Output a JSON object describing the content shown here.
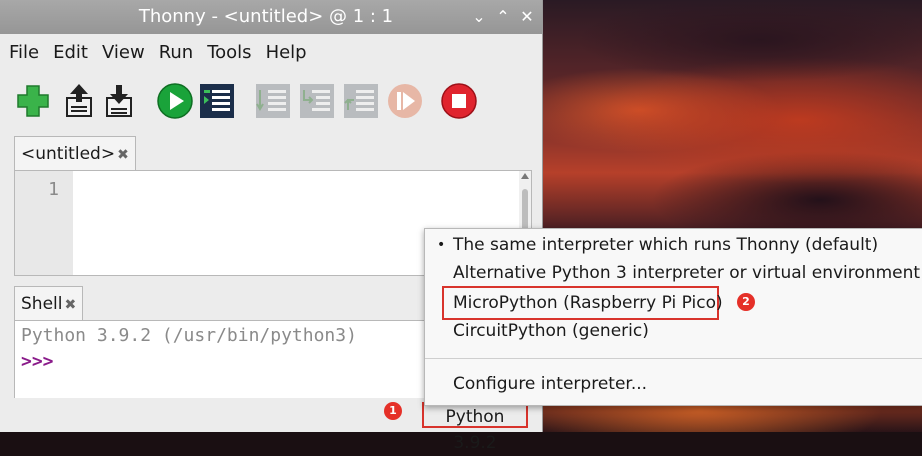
{
  "window": {
    "title": "Thonny  -  <untitled>  @  1 : 1",
    "controls": {
      "minimize": "⌄",
      "maximize": "⌃",
      "close": "✕"
    }
  },
  "menubar": [
    "File",
    "Edit",
    "View",
    "Run",
    "Tools",
    "Help"
  ],
  "toolbar": [
    {
      "name": "new-icon",
      "tooltip_role": "New",
      "enabled": true
    },
    {
      "name": "open-icon",
      "tooltip_role": "Load",
      "enabled": true
    },
    {
      "name": "save-icon",
      "tooltip_role": "Save",
      "enabled": true
    },
    {
      "name": "run-icon",
      "tooltip_role": "Run",
      "enabled": true
    },
    {
      "name": "debug-icon",
      "tooltip_role": "Debug",
      "enabled": true
    },
    {
      "name": "step-over-icon",
      "enabled": false
    },
    {
      "name": "step-into-icon",
      "enabled": false
    },
    {
      "name": "step-out-icon",
      "enabled": false
    },
    {
      "name": "resume-icon",
      "enabled": false
    },
    {
      "name": "stop-icon",
      "enabled": true
    }
  ],
  "editor": {
    "tab_label": "<untitled>",
    "close_glyph": "✖",
    "line_number": "1"
  },
  "shell": {
    "tab_label": "Shell",
    "close_glyph": "✖",
    "banner": "Python 3.9.2 (/usr/bin/python3)",
    "prompt": ">>>"
  },
  "statusbar": {
    "interpreter": "Python 3.9.2"
  },
  "interpreter_menu": {
    "items": [
      {
        "label": "The same interpreter which runs Thonny (default)",
        "selected": true
      },
      {
        "label": "Alternative Python 3 interpreter or virtual environment",
        "submenu": true
      },
      {
        "label": "MicroPython (Raspberry Pi Pico)"
      },
      {
        "label": "CircuitPython (generic)"
      }
    ],
    "footer_item": "Configure interpreter...",
    "bullet": "•",
    "submenu_arrow": "▸"
  },
  "annotations": {
    "badge_1": "1",
    "badge_2": "2",
    "highlight_color": "#d8332c"
  },
  "colors": {
    "titlebar": "#a0a0a0",
    "window_bg": "#ececec",
    "prompt": "#8a1b8a",
    "banner": "#8a8a8a",
    "run_green": "#1aa33a",
    "stop_red": "#e0242e",
    "new_green": "#3ab34a"
  }
}
